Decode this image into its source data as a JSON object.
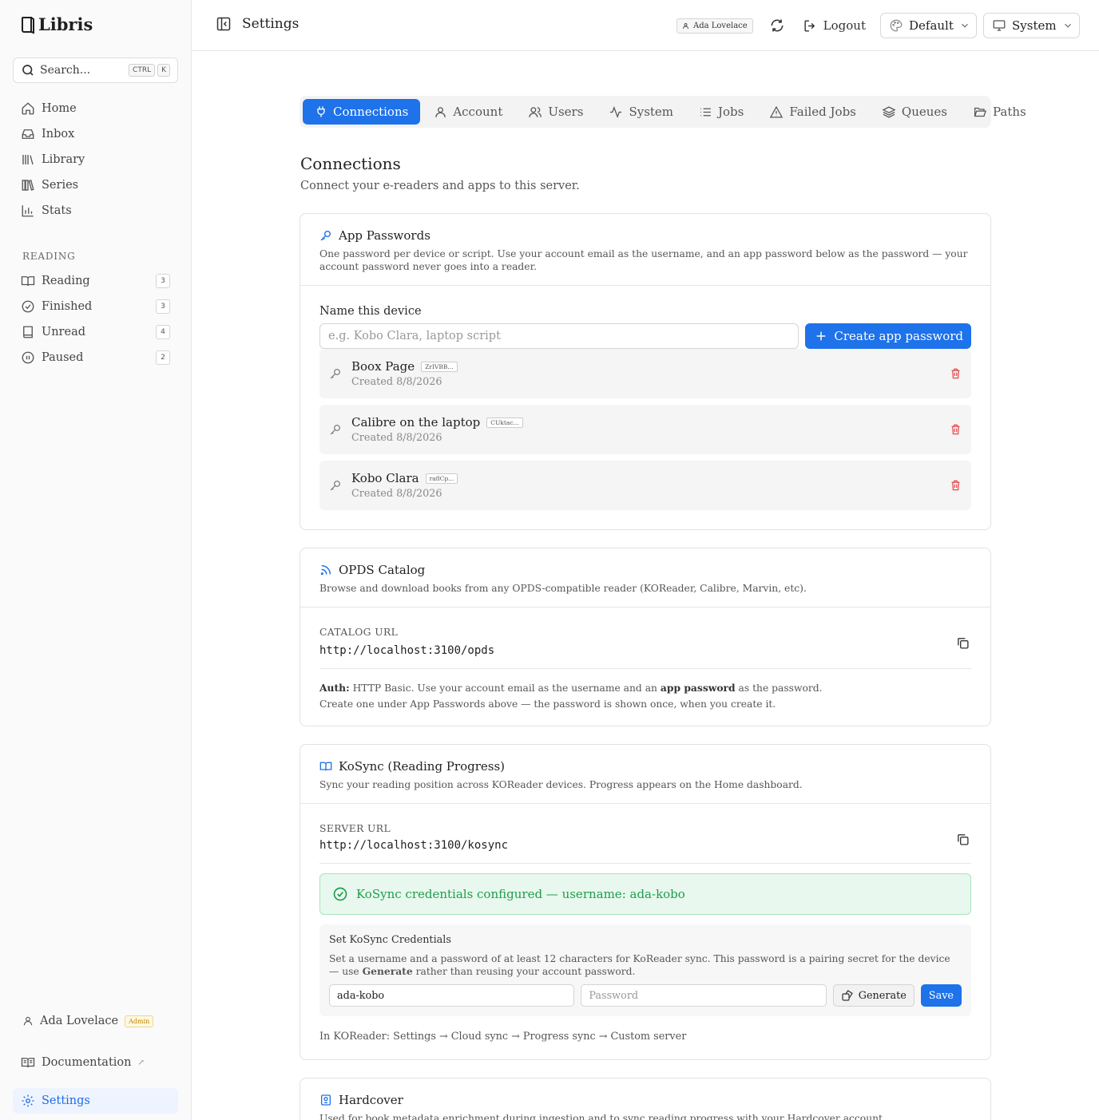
{
  "app": {
    "name": "Libris"
  },
  "search": {
    "placeholder": "Search...",
    "kbd1": "CTRL",
    "kbd2": "K"
  },
  "sidebar": {
    "nav": [
      {
        "label": "Home",
        "icon": "home-icon"
      },
      {
        "label": "Inbox",
        "icon": "inbox-icon"
      },
      {
        "label": "Library",
        "icon": "library-icon"
      },
      {
        "label": "Series",
        "icon": "series-icon"
      },
      {
        "label": "Stats",
        "icon": "stats-icon"
      }
    ],
    "reading_heading": "READING",
    "reading": [
      {
        "label": "Reading",
        "count": "3",
        "icon": "book-open-icon"
      },
      {
        "label": "Finished",
        "count": "3",
        "icon": "check-circle-icon"
      },
      {
        "label": "Unread",
        "count": "4",
        "icon": "book-icon"
      },
      {
        "label": "Paused",
        "count": "2",
        "icon": "pause-circle-icon"
      }
    ],
    "user_name": "Ada Lovelace",
    "user_badge": "Admin",
    "docs_label": "Documentation",
    "docs_ext": "↗",
    "settings_label": "Settings"
  },
  "header": {
    "title": "Settings",
    "user_chip": "Ada Lovelace",
    "logout_label": "Logout",
    "theme_label": "Default",
    "mode_label": "System"
  },
  "tabs": [
    "Connections",
    "Account",
    "Users",
    "System",
    "Jobs",
    "Failed Jobs",
    "Queues",
    "Paths"
  ],
  "page": {
    "title": "Connections",
    "subtitle": "Connect your e-readers and apps to this server."
  },
  "app_passwords": {
    "title": "App Passwords",
    "description": "One password per device or script. Use your account email as the username, and an app password below as the password — your account password never goes into a reader.",
    "field_label": "Name this device",
    "placeholder": "e.g. Kobo Clara, laptop script",
    "create_label": "Create app password",
    "items": [
      {
        "name": "Boox Page",
        "prefix": "ZrIVBB...",
        "created": "Created 8/8/2026"
      },
      {
        "name": "Calibre on the laptop",
        "prefix": "CUktac...",
        "created": "Created 8/8/2026"
      },
      {
        "name": "Kobo Clara",
        "prefix": "raflCp...",
        "created": "Created 8/8/2026"
      }
    ]
  },
  "opds": {
    "title": "OPDS Catalog",
    "description": "Browse and download books from any OPDS-compatible reader (KOReader, Calibre, Marvin, etc).",
    "url_label": "CATALOG URL",
    "url": "http://localhost:3100/opds",
    "auth_label": "Auth:",
    "auth_text_1": "HTTP Basic. Use your account email as the username and an",
    "auth_bold": "app password",
    "auth_text_2": "as the password.",
    "auth_line2": "Create one under App Passwords above — the password is shown once, when you create it."
  },
  "kosync": {
    "title": "KoSync (Reading Progress)",
    "description": "Sync your reading position across KOReader devices. Progress appears on the Home dashboard.",
    "url_label": "SERVER URL",
    "url": "http://localhost:3100/kosync",
    "status": "KoSync credentials configured — username: ada-kobo",
    "creds_title": "Set KoSync Credentials",
    "creds_desc_1": "Set a username and a password of at least 12 characters for KoReader sync. This password is a pairing secret for the device — use",
    "creds_desc_bold": "Generate",
    "creds_desc_2": "rather than reusing your account password.",
    "username_value": "ada-kobo",
    "password_placeholder": "Password",
    "generate_label": "Generate",
    "save_label": "Save",
    "hint": "In KOReader: Settings → Cloud sync → Progress sync → Custom server"
  },
  "hardcover": {
    "title": "Hardcover",
    "description": "Used for book metadata enrichment during ingestion and to sync reading progress with your Hardcover account."
  },
  "colors": {
    "accent": "#1e72ea",
    "danger": "#e5484d",
    "success": "#1f9d4c"
  }
}
